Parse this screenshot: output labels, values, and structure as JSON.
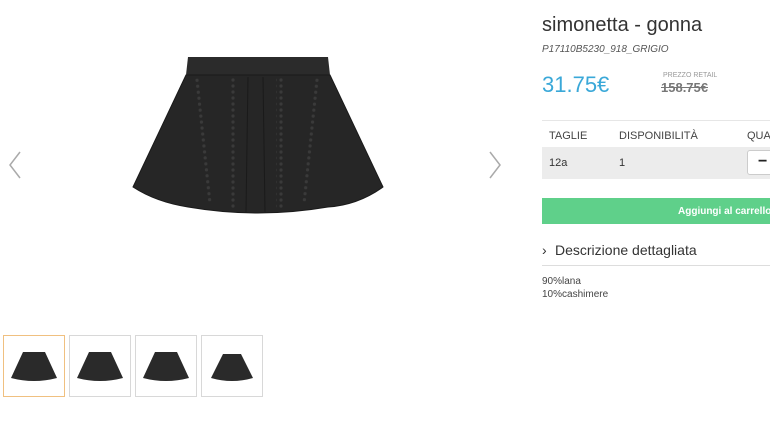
{
  "product": {
    "title": "simonetta - gonna",
    "sku": "P17110B5230_918_GRIGIO",
    "price": "31.75€",
    "retail_label": "PREZZO RETAIL",
    "retail_price": "158.75€"
  },
  "sizes": {
    "headers": [
      "TAGLIE",
      "DISPONIBILITÀ",
      "QUA"
    ],
    "rows": [
      {
        "size": "12a",
        "availability": "1",
        "qty_minus": "−"
      }
    ]
  },
  "cart_button": "Aggiungi al carrello",
  "description": {
    "toggle_label": "Descrizione dettagliata",
    "chevron": "›",
    "composition": [
      "90%lana",
      "10%cashimere"
    ]
  },
  "colors": {
    "price": "#3aa8d8",
    "cart_button": "#5fd08a",
    "active_thumb_border": "#f0c080"
  },
  "icons": {
    "prev": "chevron-left-icon",
    "next": "chevron-right-icon"
  }
}
